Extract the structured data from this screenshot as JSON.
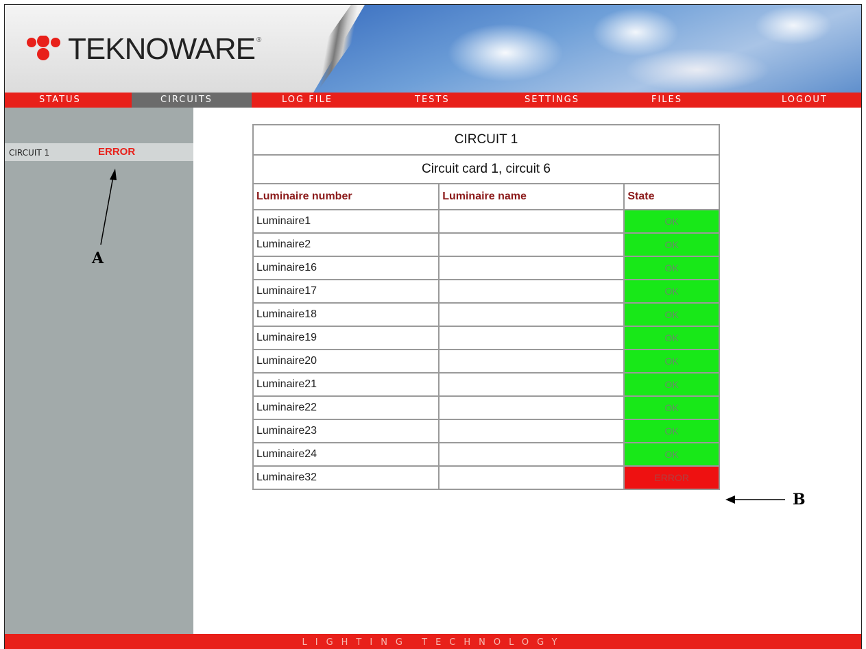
{
  "brand": {
    "name": "TEKNOWARE",
    "reg": "®"
  },
  "nav": [
    {
      "label": "STATUS",
      "active": false
    },
    {
      "label": "CIRCUITS",
      "active": true
    },
    {
      "label": "LOG FILE",
      "active": false
    },
    {
      "label": "TESTS",
      "active": false
    },
    {
      "label": "SETTINGS",
      "active": false
    },
    {
      "label": "FILES",
      "active": false
    },
    {
      "label": "LOGOUT",
      "active": false
    }
  ],
  "sidebar": {
    "items": [
      {
        "label": "CIRCUIT 1",
        "status": "ERROR"
      }
    ]
  },
  "annotations": {
    "a": "A",
    "b": "B"
  },
  "table": {
    "title": "CIRCUIT 1",
    "subtitle": "Circuit card 1, circuit 6",
    "headers": [
      "Luminaire number",
      "Luminaire name",
      "State"
    ],
    "rows": [
      {
        "number": "Luminaire1",
        "name": "",
        "state": "OK"
      },
      {
        "number": "Luminaire2",
        "name": "",
        "state": "OK"
      },
      {
        "number": "Luminaire16",
        "name": "",
        "state": "OK"
      },
      {
        "number": "Luminaire17",
        "name": "",
        "state": "OK"
      },
      {
        "number": "Luminaire18",
        "name": "",
        "state": "OK"
      },
      {
        "number": "Luminaire19",
        "name": "",
        "state": "OK"
      },
      {
        "number": "Luminaire20",
        "name": "",
        "state": "OK"
      },
      {
        "number": "Luminaire21",
        "name": "",
        "state": "OK"
      },
      {
        "number": "Luminaire22",
        "name": "",
        "state": "OK"
      },
      {
        "number": "Luminaire23",
        "name": "",
        "state": "OK"
      },
      {
        "number": "Luminaire24",
        "name": "",
        "state": "OK"
      },
      {
        "number": "Luminaire32",
        "name": "",
        "state": "ERROR"
      }
    ]
  },
  "footer": {
    "text": "LIGHTING TECHNOLOGY"
  },
  "colors": {
    "brand_red": "#e8201a",
    "ok": "#18e818",
    "error": "#ee1111",
    "sidebar": "#a2aaaa"
  }
}
